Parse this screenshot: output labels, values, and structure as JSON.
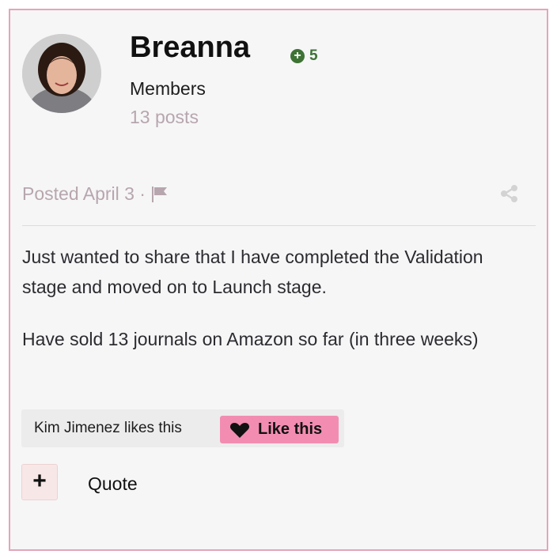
{
  "author": {
    "name": "Breanna",
    "reputation": "5",
    "group": "Members",
    "post_count": "13 posts"
  },
  "post": {
    "meta": "Posted April 3 ·",
    "paragraphs": [
      "Just wanted to share that I have completed the Validation stage and moved on to Launch stage.",
      "Have sold 13 journals on Amazon so far (in three weeks)"
    ]
  },
  "reactions": {
    "likes_text": "Kim Jimenez likes this",
    "like_button_label": "Like this"
  },
  "actions": {
    "quote_plus": "+",
    "quote_label": "Quote"
  },
  "icons": {
    "reputation": "plus-circle-icon",
    "report": "flag-icon",
    "share": "share-icon",
    "like": "heart-icon"
  },
  "colors": {
    "border": "#e2a6b8",
    "like_button": "#f28db1",
    "reputation": "#3e7335",
    "muted_text": "#b7a6ae"
  }
}
